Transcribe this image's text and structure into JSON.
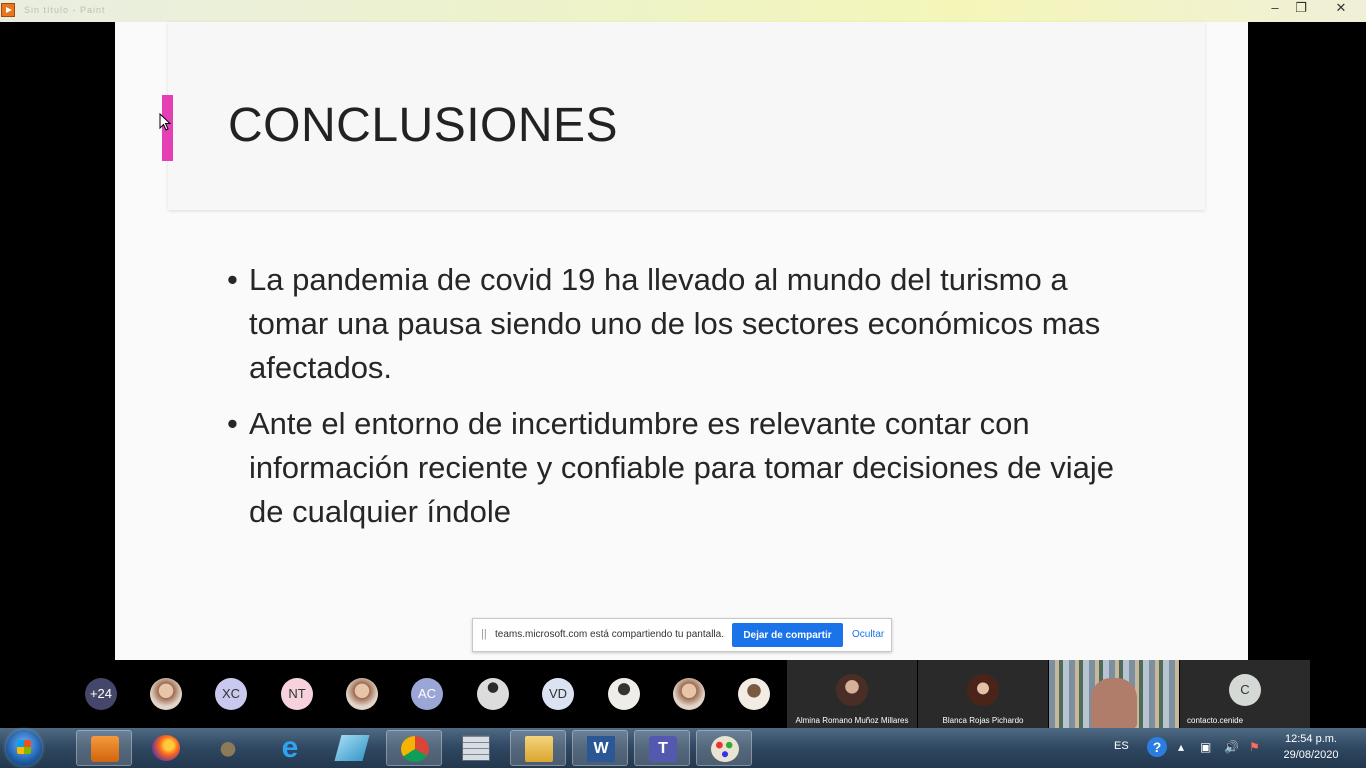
{
  "window": {
    "faded_title": "Sin título - Paint"
  },
  "slide": {
    "title": "CONCLUSIONES",
    "bullets": [
      "La pandemia de covid 19 ha llevado al mundo del turismo a tomar una pausa siendo uno de los sectores económicos mas afectados.",
      "Ante el entorno de incertidumbre es relevante contar con información reciente y confiable para tomar decisiones de viaje de cualquier índole"
    ],
    "accent_color": "#e53fb5"
  },
  "share_bar": {
    "message": "teams.microsoft.com está compartiendo tu pantalla.",
    "stop_label": "Dejar de compartir",
    "hide_label": "Ocultar"
  },
  "participants": {
    "more_count": "+24",
    "avatars": [
      {
        "initials": "",
        "kind": "photo"
      },
      {
        "initials": "XC",
        "color": "#c9c9f0",
        "kind": "initials"
      },
      {
        "initials": "NT",
        "color": "#f6d3dc",
        "kind": "initials"
      },
      {
        "initials": "",
        "kind": "photo"
      },
      {
        "initials": "AC",
        "color": "#9aa6d6",
        "kind": "initials"
      },
      {
        "initials": "",
        "kind": "photo"
      },
      {
        "initials": "VD",
        "color": "#dbe3f3",
        "kind": "initials"
      },
      {
        "initials": "",
        "kind": "photo"
      },
      {
        "initials": "",
        "kind": "photo"
      },
      {
        "initials": "",
        "kind": "photo"
      }
    ],
    "tiles": [
      {
        "name": "Almina Romano Muñoz Millares"
      },
      {
        "name": "Blanca Rojas Pichardo"
      },
      {
        "name": ""
      },
      {
        "name": "contacto.cenide",
        "initial": "C"
      }
    ]
  },
  "taskbar": {
    "language": "ES",
    "help": "?",
    "time": "12:54 p.m.",
    "date": "29/08/2020"
  }
}
